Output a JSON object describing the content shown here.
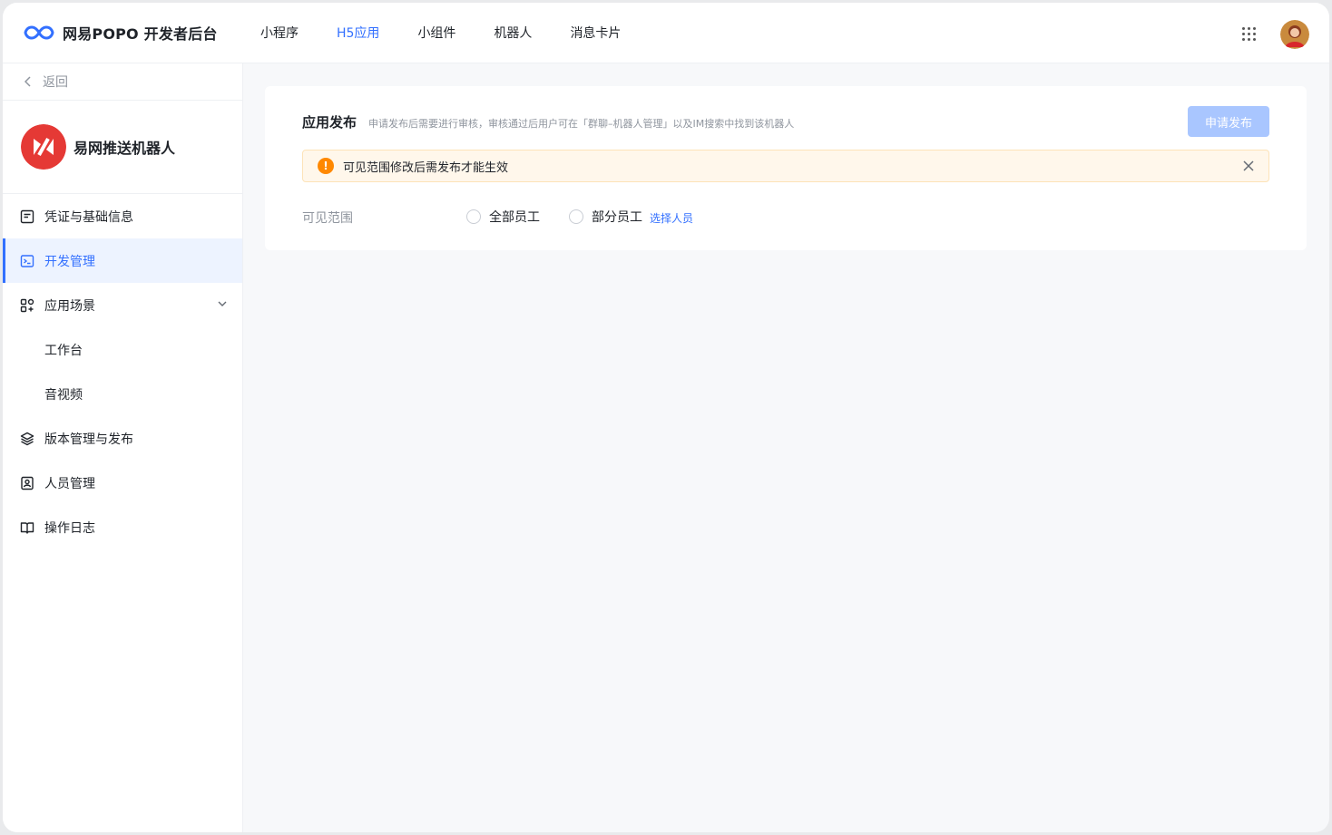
{
  "brand": {
    "title": "网易POPO 开发者后台"
  },
  "topnav": [
    {
      "label": "小程序",
      "active": false
    },
    {
      "label": "H5应用",
      "active": true
    },
    {
      "label": "小组件",
      "active": false
    },
    {
      "label": "机器人",
      "active": false
    },
    {
      "label": "消息卡片",
      "active": false
    }
  ],
  "sidebar": {
    "back_label": "返回",
    "app_name": "易网推送机器人",
    "items": [
      {
        "label": "凭证与基础信息",
        "icon": "document-icon"
      },
      {
        "label": "开发管理",
        "icon": "terminal-icon",
        "active": true
      },
      {
        "label": "应用场景",
        "icon": "apps-icon",
        "expanded": true
      },
      {
        "label": "工作台",
        "sub": true
      },
      {
        "label": "音视频",
        "sub": true
      },
      {
        "label": "版本管理与发布",
        "icon": "layers-icon"
      },
      {
        "label": "人员管理",
        "icon": "contact-icon"
      },
      {
        "label": "操作日志",
        "icon": "book-icon"
      }
    ]
  },
  "main": {
    "title": "应用发布",
    "description": "申请发布后需要进行审核，审核通过后用户可在「群聊–机器人管理」以及IM搜索中找到该机器人",
    "publish_button": "申请发布",
    "notice": "可见范围修改后需发布才能生效",
    "visibility_label": "可见范围",
    "options": [
      "全部员工",
      "部分员工"
    ],
    "select_link": "选择人员"
  },
  "colors": {
    "accent": "#3370ff",
    "warning": "#ff8800",
    "brand_red": "#e53935"
  }
}
